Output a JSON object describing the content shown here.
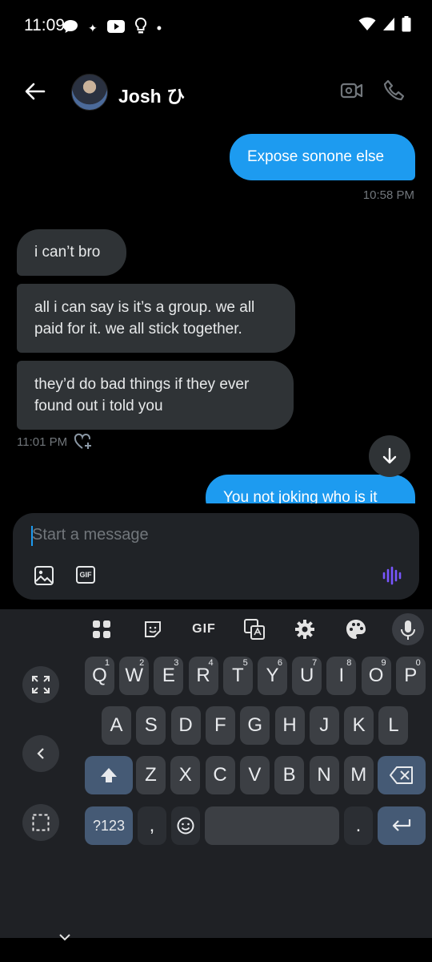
{
  "status_bar": {
    "time": "11:09"
  },
  "header": {
    "contact_name": "Josh ひ"
  },
  "messages": [
    {
      "text": "Expose sonone else",
      "timestamp": "10:58 PM"
    },
    {
      "text": "i can’t bro"
    },
    {
      "text_line1": "all i can say is it’s a group. we all",
      "text_line2": "paid for it. we all stick together."
    },
    {
      "text_line1": "they’d do bad things if they ever",
      "text_line2": "found out i told you",
      "timestamp": "11:01 PM"
    },
    {
      "text": "You not joking who is it"
    }
  ],
  "composer": {
    "placeholder": "Start a message",
    "gif_label": "GIF"
  },
  "keyboard": {
    "toolbar_gif": "GIF",
    "row1": [
      {
        "k": "Q",
        "n": "1"
      },
      {
        "k": "W",
        "n": "2"
      },
      {
        "k": "E",
        "n": "3"
      },
      {
        "k": "R",
        "n": "4"
      },
      {
        "k": "T",
        "n": "5"
      },
      {
        "k": "Y",
        "n": "6"
      },
      {
        "k": "U",
        "n": "7"
      },
      {
        "k": "I",
        "n": "8"
      },
      {
        "k": "O",
        "n": "9"
      },
      {
        "k": "P",
        "n": "0"
      }
    ],
    "row2": [
      "A",
      "S",
      "D",
      "F",
      "G",
      "H",
      "J",
      "K",
      "L"
    ],
    "row3": [
      "Z",
      "X",
      "C",
      "V",
      "B",
      "N",
      "M"
    ],
    "symbols_key": "?123",
    "comma_key": ",",
    "period_key": "."
  },
  "colors": {
    "accent": "#1d9bf0",
    "bubble_in": "#2f3336",
    "voice_accent": "#7856ff"
  }
}
